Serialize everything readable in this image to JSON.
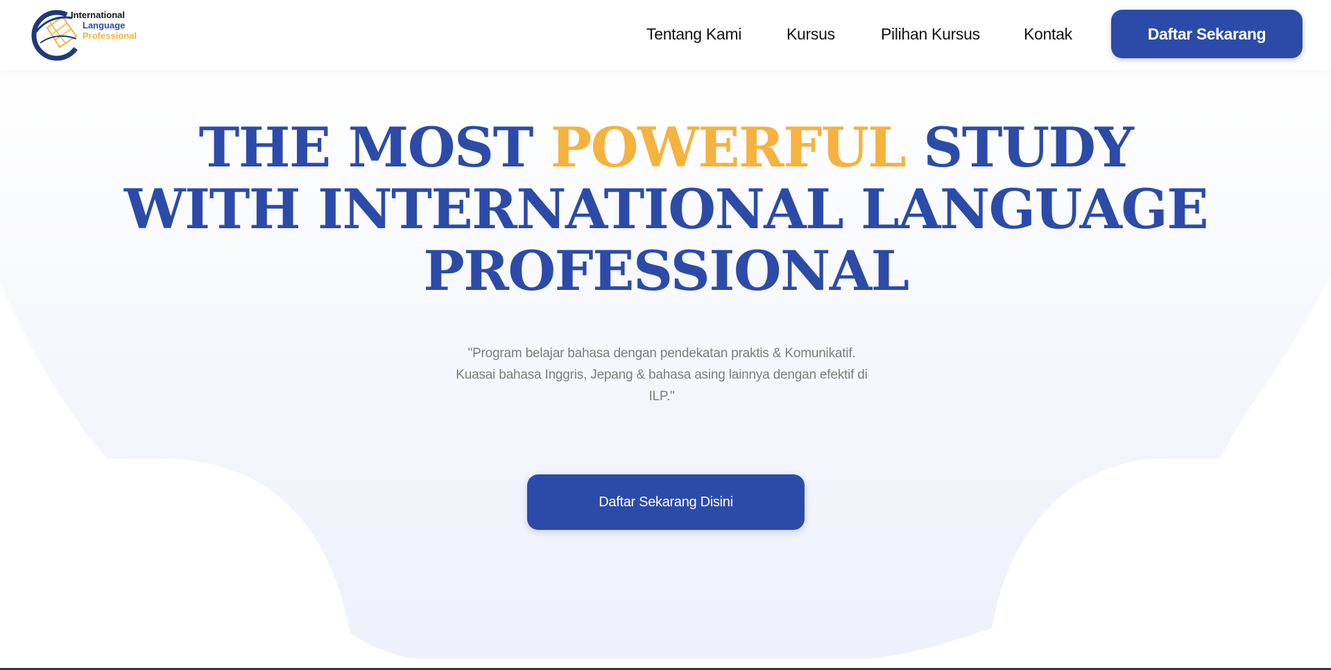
{
  "brand": {
    "line1": "International",
    "line2": "Language",
    "line3": "Professional"
  },
  "nav": {
    "about": "Tentang Kami",
    "courses": "Kursus",
    "course_options": "Pilihan Kursus",
    "contact": "Kontak",
    "register_button": "Daftar Sekarang"
  },
  "hero": {
    "title_part1": "THE MOST ",
    "title_highlight": "POWERFUL",
    "title_part2": " STUDY WITH INTERNATIONAL LANGUAGE PROFESSIONAL",
    "quote": "\"Program belajar bahasa dengan pendekatan praktis & Komunikatif. Kuasai bahasa Inggris, Jepang & bahasa asing lainnya dengan efektif di ILP.\"",
    "cta_button": "Daftar Sekarang Disini"
  },
  "colors": {
    "primary": "#2c4ba9",
    "accent": "#f6b23f",
    "text_muted": "#7d7d7d"
  }
}
